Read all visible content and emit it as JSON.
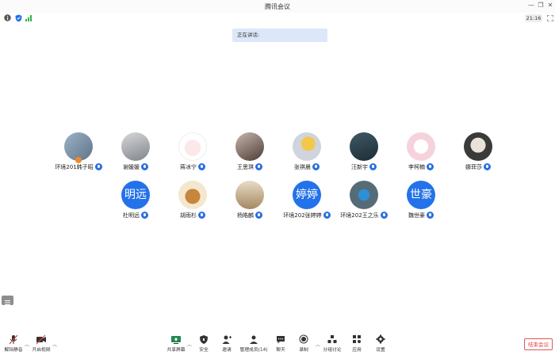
{
  "window": {
    "title": "腾讯会议"
  },
  "topbar": {
    "time": "21:16"
  },
  "speaking": {
    "label": "正在讲话:"
  },
  "participants": [
    {
      "name": "环境201韩子昭",
      "avatar": "photo"
    },
    {
      "name": "谢媛媛",
      "avatar": "photo"
    },
    {
      "name": "蒋冰宁",
      "avatar": "photo"
    },
    {
      "name": "王思琪",
      "avatar": "photo"
    },
    {
      "name": "张祺晨",
      "avatar": "photo"
    },
    {
      "name": "汪新宇",
      "avatar": "photo"
    },
    {
      "name": "李柯楠",
      "avatar": "photo"
    },
    {
      "name": "娜菲莎",
      "avatar": "photo"
    },
    {
      "name": "杜明远",
      "avatar": "text",
      "initials": "明远"
    },
    {
      "name": "胡雨杉",
      "avatar": "photo"
    },
    {
      "name": "杨皓麟",
      "avatar": "photo"
    },
    {
      "name": "环境202张婷婷",
      "avatar": "text",
      "initials": "婷婷"
    },
    {
      "name": "环境202王之乐",
      "avatar": "photo"
    },
    {
      "name": "魏世豪",
      "avatar": "text",
      "initials": "世豪"
    }
  ],
  "toolbar": {
    "unmute": "解除静音",
    "start_video": "开启视频",
    "share_screen": "共享屏幕",
    "security": "安全",
    "invite": "邀请",
    "manage_members": "管理成员(14)",
    "chat": "聊天",
    "record": "录制",
    "breakout": "分组讨论",
    "apps": "应用",
    "settings": "设置",
    "end": "结束会议"
  },
  "colors": {
    "accent": "#2472ea",
    "end": "#e03e3e",
    "speaking_bg": "#dce8f9"
  }
}
